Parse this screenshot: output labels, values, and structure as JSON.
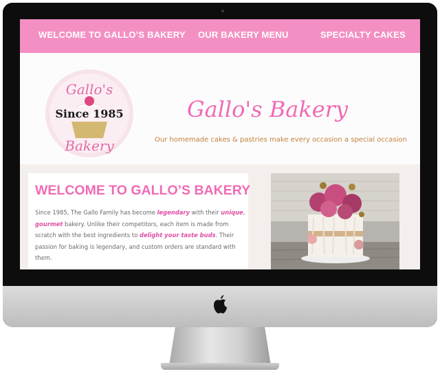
{
  "nav": {
    "items": [
      {
        "label": "WELCOME TO GALLO’S BAKERY"
      },
      {
        "label": "OUR BAKERY MENU"
      },
      {
        "label": "SPECIALTY CAKES"
      }
    ]
  },
  "logo": {
    "line1": "Gallo's",
    "line2": "Since 1985",
    "line3": "Bakery"
  },
  "header": {
    "title": "Gallo's Bakery",
    "tagline": "Our homemade cakes & pastries make every occasion a special occasion"
  },
  "welcome": {
    "heading": "WELCOME TO GALLO’S BAKERY",
    "p1": "Since 1985, The Gallo Family has become ",
    "hl1": "legendary",
    "p2": " with their ",
    "hl2": "unique",
    "p3": ", ",
    "hl3": "gourmet",
    "p4": " bakery. Unlike their competitors, each item is made from scratch with the best ingredients to ",
    "hl4": "delight your taste buds",
    "p5": ". Their passion for baking is legendary, and custom orders are standard with them."
  },
  "colors": {
    "nav": "#f48fc3",
    "accent_pink": "#f06bb4",
    "tagline": "#c2803c",
    "content_bg": "#f4efec"
  }
}
